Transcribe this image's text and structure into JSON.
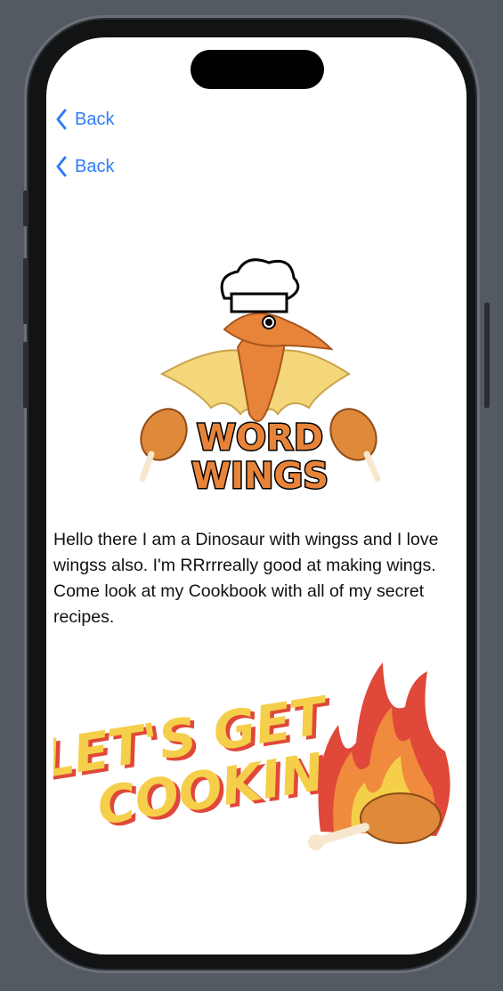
{
  "nav": {
    "back_buttons": [
      {
        "label": "Back",
        "icon": "chevron-left-icon"
      },
      {
        "label": "Back",
        "icon": "chevron-left-icon"
      }
    ]
  },
  "logo": {
    "line1": "WORD",
    "line2": "WINGS"
  },
  "bio": {
    "text": "Hello there I am a Dinosaur with wingss and I love wingss also. I'm RRrrreally good at making wings. Come look at my Cookbook with all of my secret recipes."
  },
  "banner": {
    "line1": "LET'S GET",
    "line2": "COOKIN'"
  },
  "colors": {
    "accent": "#2f7cf6",
    "logo_orange": "#e8843a",
    "wing_yellow": "#f3d77a",
    "banner_yellow": "#f5cf4a",
    "banner_red": "#e0483a"
  }
}
